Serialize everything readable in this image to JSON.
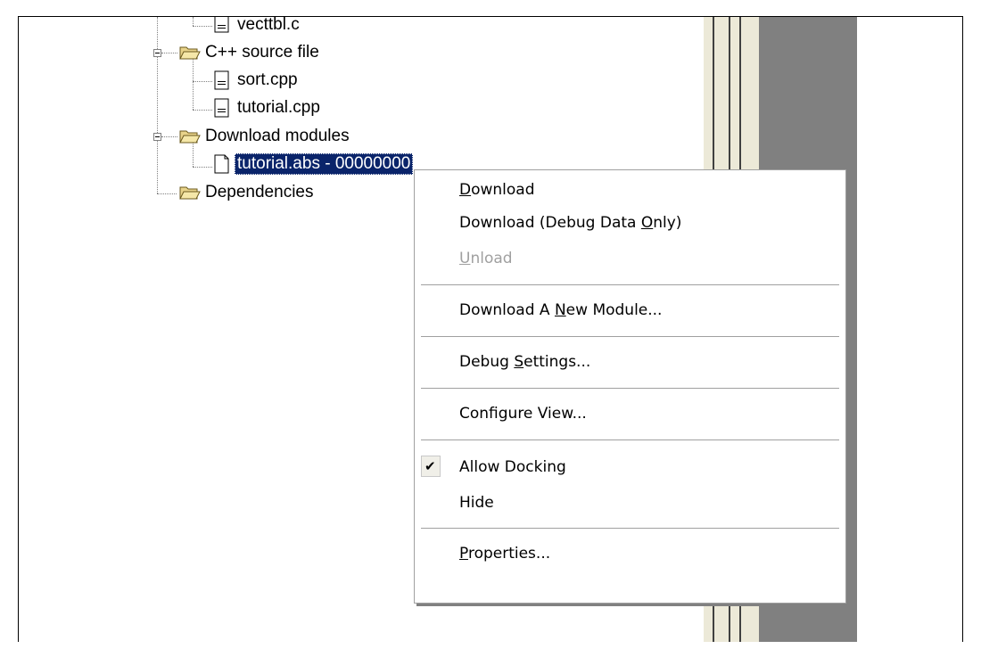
{
  "tree": {
    "items": [
      {
        "label": "vecttbl.c",
        "icon": "source-file-icon"
      },
      {
        "label": "C++ source file",
        "icon": "folder-icon"
      },
      {
        "label": "sort.cpp",
        "icon": "source-file-icon"
      },
      {
        "label": "tutorial.cpp",
        "icon": "source-file-icon"
      },
      {
        "label": "Download modules",
        "icon": "folder-icon"
      },
      {
        "label": "tutorial.abs - 00000000",
        "icon": "blank-file-icon"
      },
      {
        "label": "Dependencies",
        "icon": "folder-icon"
      }
    ]
  },
  "menu": {
    "download": {
      "mnemonic": "D",
      "rest": "ownload"
    },
    "download_debug": {
      "before": "Download (Debug Data ",
      "mnemonic": "O",
      "after": "nly)"
    },
    "unload": {
      "mnemonic": "U",
      "rest": "nload",
      "disabled": true
    },
    "download_new": {
      "before": "Download A ",
      "mnemonic": "N",
      "after": "ew Module..."
    },
    "debug_settings": {
      "before": "Debug ",
      "mnemonic": "S",
      "after": "ettings..."
    },
    "configure_view": {
      "label": "Configure View..."
    },
    "allow_docking": {
      "label": "Allow Docking",
      "checked": true,
      "check_glyph": "✔"
    },
    "hide": {
      "label": "Hide"
    },
    "properties": {
      "mnemonic": "P",
      "rest": "roperties..."
    }
  },
  "colors": {
    "selection": "#0a246a",
    "menu_border": "#a0a0a0",
    "dark_panel": "#808080",
    "splitter": "#ece9d8"
  }
}
